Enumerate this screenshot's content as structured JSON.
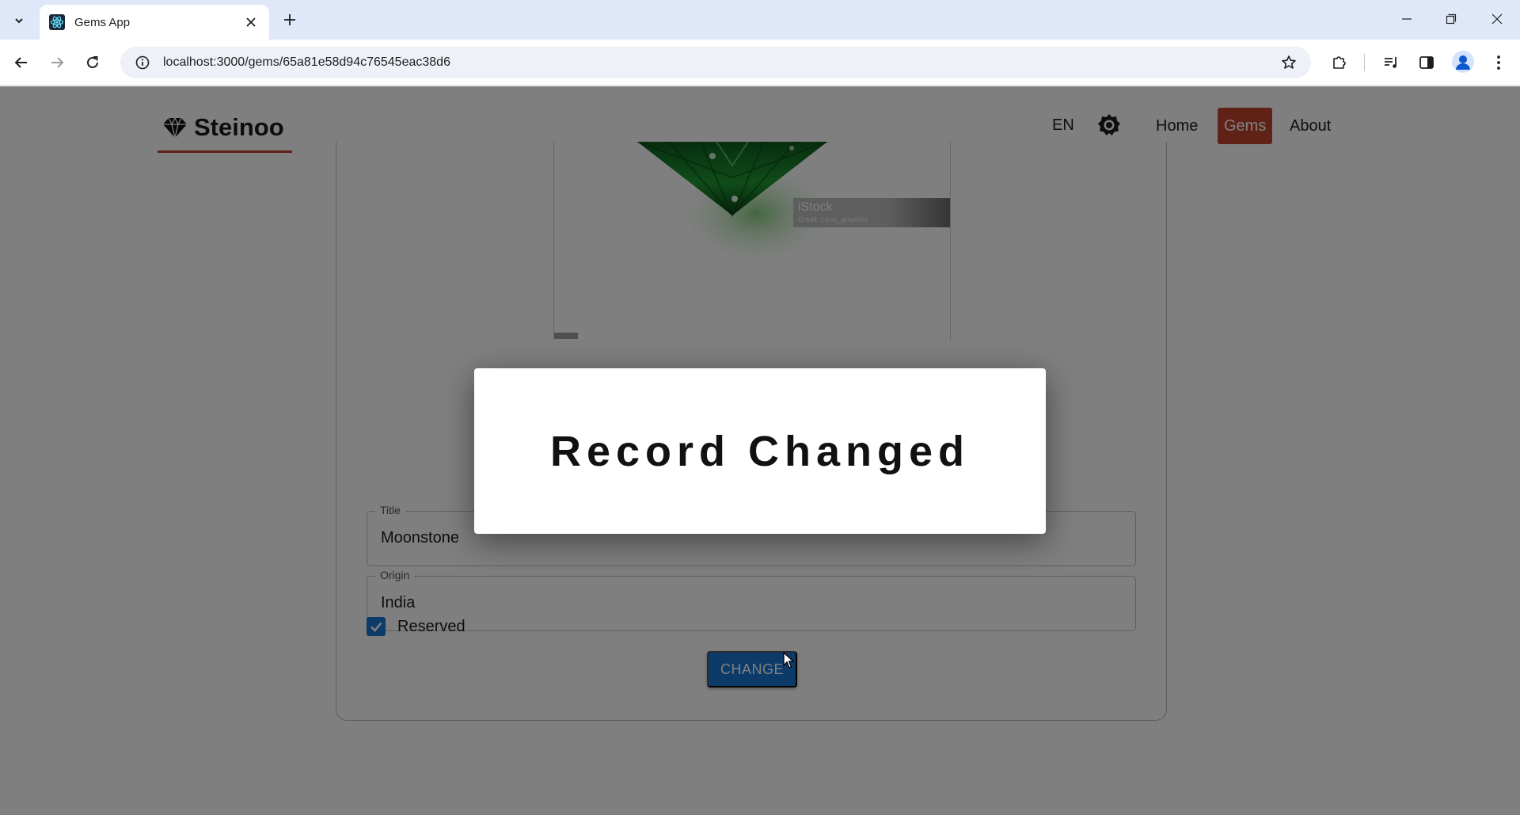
{
  "browser": {
    "tab_title": "Gems App",
    "url": "localhost:3000/gems/65a81e58d94c76545eac38d6",
    "icons": {
      "tab_search": "chevron-down-icon",
      "favicon": "react-icon",
      "tab_close": "close-icon",
      "new_tab": "plus-icon",
      "back": "back-arrow-icon",
      "forward": "forward-arrow-icon",
      "reload": "reload-icon",
      "site_info": "info-icon",
      "bookmark": "star-icon",
      "extensions": "puzzle-icon",
      "media": "media-control-icon",
      "side_panel": "side-panel-icon",
      "profile": "profile-icon",
      "menu": "kebab-menu-icon",
      "minimize": "minimize-icon",
      "restore": "restore-icon",
      "close_window": "close-icon"
    }
  },
  "app": {
    "brand": "Steinoo",
    "brand_icon": "diamond-icon",
    "language": "EN",
    "theme_icon": "brightness-icon",
    "nav": [
      {
        "label": "Home",
        "active": false
      },
      {
        "label": "Gems",
        "active": true
      },
      {
        "label": "About",
        "active": false
      }
    ],
    "colors": {
      "accent": "#c0452f",
      "primary": "#1976d2",
      "gem": "#1d8a2e"
    }
  },
  "image": {
    "watermark_brand": "iStock",
    "watermark_credit": "Credit: Leno_graphics"
  },
  "form": {
    "title_label": "Title",
    "title_value": "Moonstone",
    "origin_label": "Origin",
    "origin_value": "India",
    "reserved_label": "Reserved",
    "reserved_checked": true,
    "submit_label": "CHANGE"
  },
  "modal": {
    "message": "Record Changed"
  }
}
